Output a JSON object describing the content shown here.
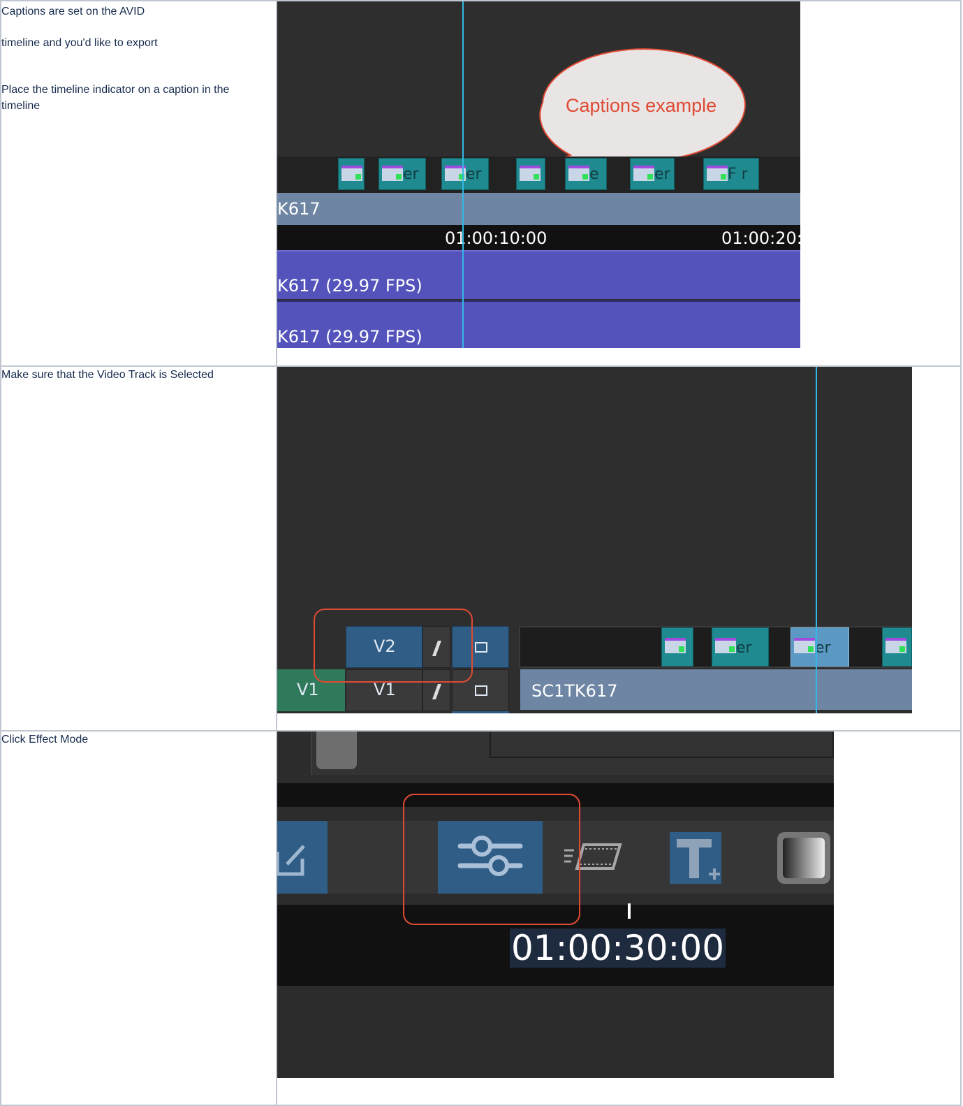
{
  "rows": [
    {
      "paragraphs": [
        "Captions are set on the AVID",
        "timeline and you'd like to export",
        "Place the timeline indicator on a caption in the timeline"
      ],
      "screenshot": {
        "callout_text": "Captions example",
        "clip_labels": [
          "",
          "er",
          "er",
          "",
          "e",
          "er",
          "F r"
        ],
        "timeline_clip_name": "K617",
        "timecodes": [
          "01:00:10:00",
          "01:00:20:0"
        ],
        "tracks": [
          "K617 (29.97 FPS)",
          "K617 (29.97 FPS)"
        ],
        "colors": {
          "callout_fill": "#e9e5e5",
          "callout_border": "#e04a34",
          "callout_text": "#e04a34",
          "playhead": "#33b8e6",
          "track": "#5353bb"
        }
      }
    },
    {
      "paragraphs": [
        "Make sure that the Video Track is Selected"
      ],
      "screenshot": {
        "track_buttons": {
          "v2": "V2",
          "v1_record": "V1",
          "v1_source": "V1"
        },
        "clip_labels": [
          "",
          "er",
          "er",
          ""
        ],
        "timeline_clip_name": "SC1TK617",
        "colors": {
          "highlight_border": "#e04a34",
          "v2_selected": "#2f5d86",
          "v1_source": "#2f7a5a"
        }
      }
    },
    {
      "paragraphs": [
        "Click Effect Mode"
      ],
      "screenshot": {
        "timecode": "01:00:30:00",
        "toolbar_icons": [
          "edit-icon",
          "effect-mode-icon",
          "film-icon",
          "title-tool-icon",
          "gradient-icon"
        ],
        "colors": {
          "highlight_border": "#e04a34",
          "effect_button": "#2f5d86",
          "timecode_bg": "#1e2a3e"
        }
      }
    }
  ]
}
